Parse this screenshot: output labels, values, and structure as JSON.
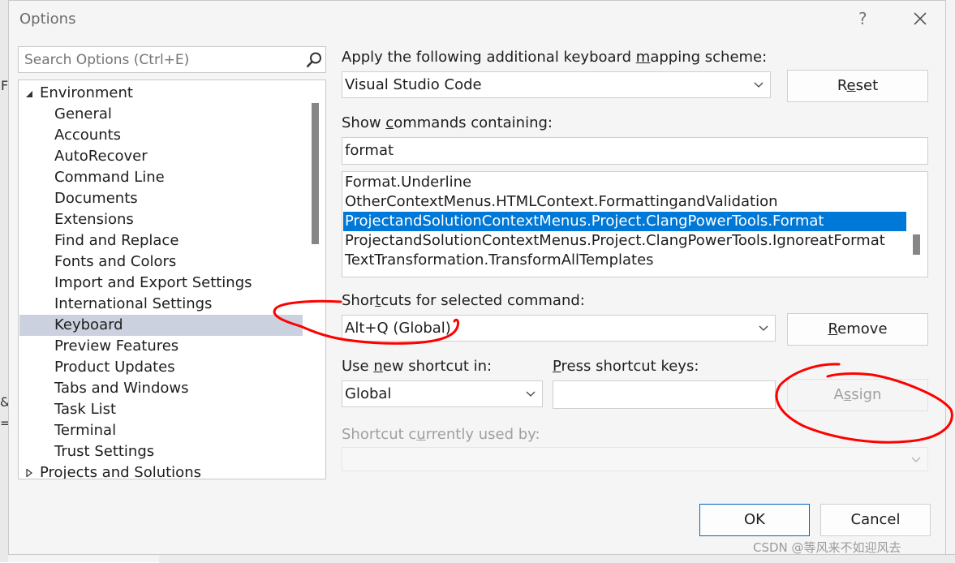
{
  "dialog": {
    "title": "Options",
    "help": "?"
  },
  "search": {
    "placeholder": "Search Options (Ctrl+E)"
  },
  "tree": {
    "environment": "Environment",
    "items": [
      "General",
      "Accounts",
      "AutoRecover",
      "Command Line",
      "Documents",
      "Extensions",
      "Find and Replace",
      "Fonts and Colors",
      "Import and Export Settings",
      "International Settings",
      "Keyboard",
      "Preview Features",
      "Product Updates",
      "Tabs and Windows",
      "Task List",
      "Terminal",
      "Trust Settings"
    ],
    "selected": "Keyboard",
    "projects": "Projects and Solutions"
  },
  "mapping": {
    "label_pre": "Apply the following additional keyboard ",
    "label_u": "m",
    "label_post": "apping scheme:",
    "value": "Visual Studio Code",
    "reset_pre": "R",
    "reset_u": "e",
    "reset_post": "set"
  },
  "commands": {
    "label_pre": "Show ",
    "label_u": "c",
    "label_post": "ommands containing:",
    "filter": "format",
    "items": [
      "Format.Underline",
      "OtherContextMenus.HTMLContext.FormattingandValidation",
      "ProjectandSolutionContextMenus.Project.ClangPowerTools.Format",
      "ProjectandSolutionContextMenus.Project.ClangPowerTools.IgnoreatFormat",
      "TextTransformation.TransformAllTemplates"
    ],
    "selected_index": 2
  },
  "shortcut": {
    "label_pre": "Shor",
    "label_u": "t",
    "label_post": "cuts for selected command:",
    "value": "Alt+Q (Global)",
    "remove_u": "R",
    "remove_post": "emove"
  },
  "new_shortcut": {
    "use_in_pre": "Use ",
    "use_in_u": "n",
    "use_in_post": "ew shortcut in:",
    "use_in_value": "Global",
    "press_u": "P",
    "press_post": "ress shortcut keys:",
    "assign_pre": "A",
    "assign_u": "s",
    "assign_post": "sign"
  },
  "used_by": {
    "label_pre": "Shortcut c",
    "label_u": "u",
    "label_post": "rrently used by:"
  },
  "footer": {
    "ok": "OK",
    "cancel": "Cancel"
  },
  "watermark": "CSDN @等风来不如迎风去",
  "background": {
    "glyph_1": "F",
    "glyph_2": "&",
    "glyph_3": "="
  },
  "colors": {
    "selection_blue": "#0078d7",
    "tree_selection": "#ccd1df",
    "annotation_red": "#ff0000"
  }
}
